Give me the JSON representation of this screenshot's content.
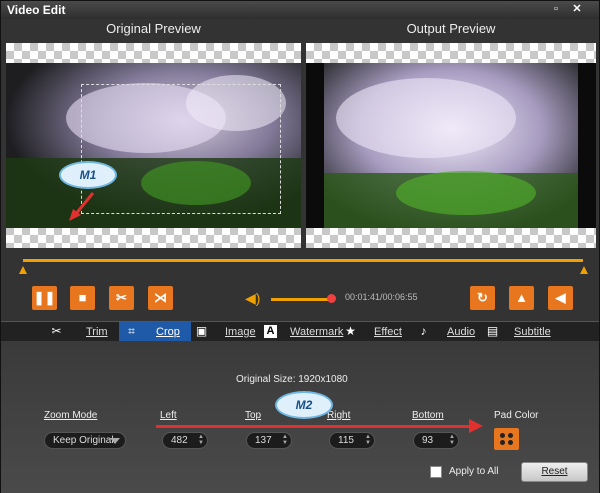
{
  "window": {
    "title": "Video Edit",
    "max_glyph": "▫",
    "close_glyph": "✕"
  },
  "preview": {
    "original_label": "Original Preview",
    "output_label": "Output Preview"
  },
  "callouts": {
    "m1": "M1",
    "m2": "M2"
  },
  "controls": {
    "play_icon": "pause-icon",
    "timecode": "00:01:41/00:06:55",
    "volume_level": 0.9
  },
  "tabs": [
    {
      "label": "Trim",
      "icon": "scissors-icon",
      "glyph": "✂"
    },
    {
      "label": "Crop",
      "icon": "crop-icon",
      "glyph": "⌗"
    },
    {
      "label": "Image",
      "icon": "image-icon",
      "glyph": "▣"
    },
    {
      "label": "Watermark",
      "icon": "watermark-icon",
      "glyph": "A"
    },
    {
      "label": "Effect",
      "icon": "star-icon",
      "glyph": "★"
    },
    {
      "label": "Audio",
      "icon": "music-note-icon",
      "glyph": "♪"
    },
    {
      "label": "Subtitle",
      "icon": "film-icon",
      "glyph": "▤"
    }
  ],
  "crop": {
    "original_size": "Original Size:  1920x1080",
    "zoom_mode_label": "Zoom Mode",
    "zoom_mode_value": "Keep Original",
    "left_label": "Left",
    "left_value": "482",
    "top_label": "Top",
    "top_value": "137",
    "right_label": "Right",
    "right_value": "115",
    "bottom_label": "Bottom",
    "bottom_value": "93",
    "pad_color_label": "Pad Color",
    "apply_all_label": "Apply to All",
    "reset_label": "Reset"
  },
  "colors": {
    "accent": "#e8761f",
    "active_tab": "#1f5aa8",
    "timeline": "#f0a000",
    "annotation": "#e03030"
  }
}
